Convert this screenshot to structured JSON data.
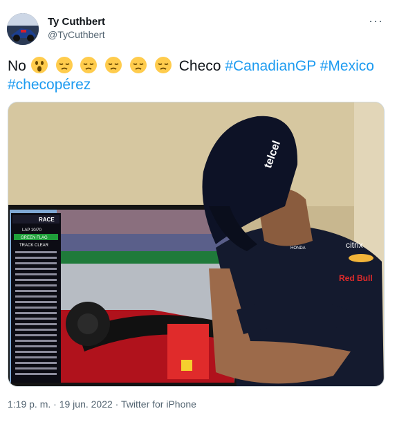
{
  "author": {
    "name": "Ty Cuthbert",
    "handle": "@TyCuthbert"
  },
  "menu": {
    "more_label": "···"
  },
  "tweet": {
    "text_prefix": "No",
    "emojis": [
      "astonished-face",
      "disappointed-face",
      "disappointed-face",
      "disappointed-face",
      "disappointed-face",
      "disappointed-face"
    ],
    "text_word": "Checo",
    "hashtags": [
      "#CanadianGP",
      "#Mexico",
      "#checopérez"
    ]
  },
  "image": {
    "overlay": {
      "header": "RACE",
      "lap": "LAP 10/70",
      "flag": "GREEN FLAG",
      "status": "TRACK CLEAR"
    },
    "brands": {
      "cap": "telcel",
      "shirt_1": "citrix",
      "shirt_2": "HONDA",
      "shirt_3": "Red Bull"
    }
  },
  "meta": {
    "time": "1:19 p. m.",
    "date": "19 jun. 2022",
    "source": "Twitter for iPhone",
    "separator": " · "
  },
  "colors": {
    "link": "#1d9bf0",
    "muted": "#536471",
    "text": "#0f1419"
  }
}
